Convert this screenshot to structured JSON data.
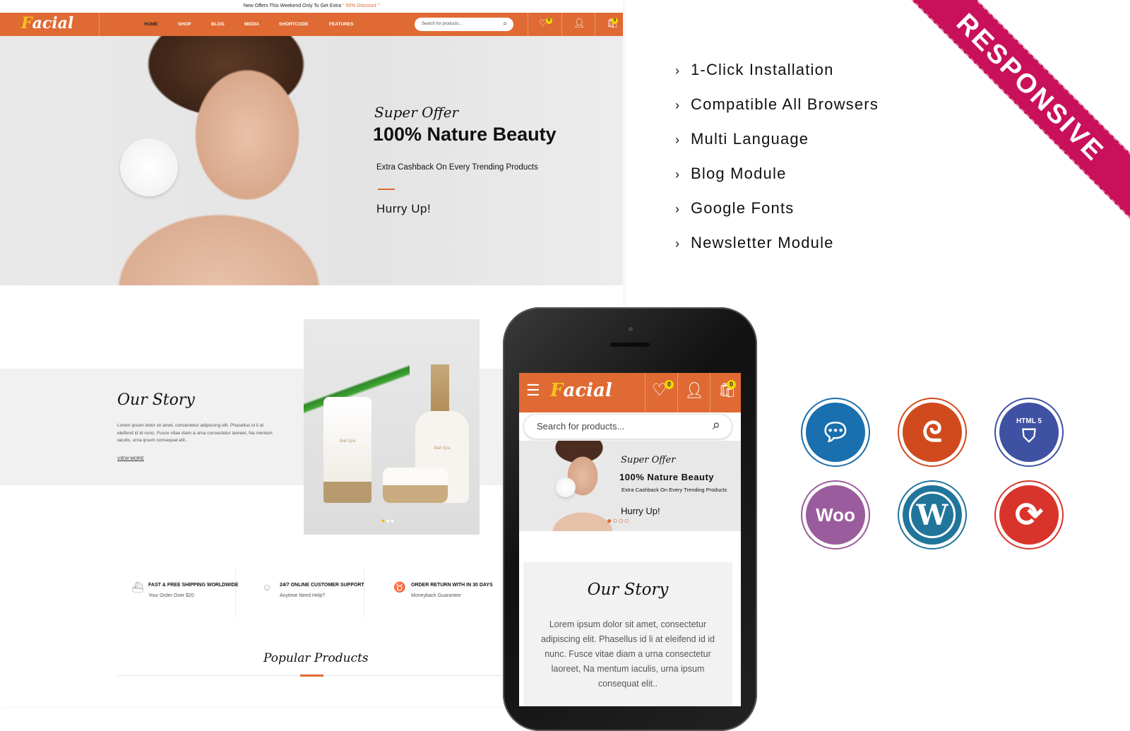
{
  "topbar": {
    "text": "New Offers This Weekend Only To Get Extra",
    "discount": "\" 50% Discount \""
  },
  "brand": {
    "logo_first": "F",
    "logo_rest": "acial",
    "accent": "#df6a33",
    "ribbon_color": "#c8115a"
  },
  "nav": {
    "items": [
      "HOME",
      "SHOP",
      "BLOG",
      "MEDIA",
      "SHORTCODE",
      "FEATURES"
    ],
    "search_placeholder": "Search for products...",
    "wishlist_count": "0",
    "cart_count": "0"
  },
  "hero": {
    "kicker": "Super Offer",
    "title": "100% Nature Beauty",
    "subtitle": "Extra Cashback On Every Trending Products",
    "cta": "Hurry Up!"
  },
  "story": {
    "title": "Our Story",
    "body": "Lorem ipsum dolor sit amet, consectetur adipiscing elit. Phasellus id li at eleifend id id nunc. Fusce vitae diam a urna consectetur laoreet, Na mentum iaculis, urna ipsum consequat elit..",
    "link": "VIEW MORE",
    "product_label_1": "Bali Spa",
    "product_label_2": "Bali Spa"
  },
  "features": [
    {
      "title": "FAST & FREE SHIPPING WORLDWIDE",
      "sub": "Your Order Over $20",
      "icon": "ship-icon"
    },
    {
      "title": "24/7 ONLINE CUSTOMER SUPPORT",
      "sub": "Anytime Need Help?",
      "icon": "support-icon"
    },
    {
      "title": "ORDER RETURN WITH IN 30 DAYS",
      "sub": "Moneyback Guarantee",
      "icon": "piggy-bank-icon"
    }
  ],
  "popular": {
    "title": "Popular Products"
  },
  "highlights": [
    "1-Click Installation",
    "Compatible All Browsers",
    "Multi Language",
    "Blog Module",
    "Google Fonts",
    "Newsletter Module"
  ],
  "ribbon": "RESPONSIVE",
  "mobile": {
    "search_placeholder": "Search for products...",
    "wishlist_count": "0",
    "cart_count": "0",
    "hero_kicker": "Super Offer",
    "hero_title": "100% Nature Beauty",
    "hero_sub": "Extra Cashback On Every Trending Products",
    "hero_cta": "Hurry Up!",
    "story_title": "Our Story",
    "story_body": "Lorem ipsum dolor sit amet, consectetur adipiscing elit. Phasellus id li at eleifend id id nunc. Fusce vitae diam a urna consectetur laoreet, Na mentum iaculis, urna ipsum consequat elit.."
  },
  "tech_icons": [
    {
      "name": "chat-bubbles-icon",
      "color": "#1a6fae",
      "label": ""
    },
    {
      "name": "customizer-icon",
      "color": "#d14a1e",
      "label": ""
    },
    {
      "name": "html5-icon",
      "color": "#3f51a3",
      "label": "HTML 5"
    },
    {
      "name": "woocommerce-icon",
      "color": "#9b5c9d",
      "label": "Woo"
    },
    {
      "name": "wordpress-icon",
      "color": "#21759b",
      "label": "W"
    },
    {
      "name": "update-icon",
      "color": "#d9342b",
      "label": "⟳"
    }
  ]
}
